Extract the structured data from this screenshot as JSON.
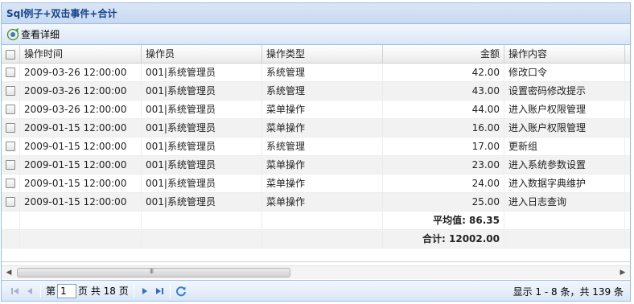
{
  "panel": {
    "title": "Sql例子+双击事件+合计"
  },
  "toolbar": {
    "view_detail_label": "查看详细"
  },
  "grid": {
    "columns": [
      "操作时间",
      "操作员",
      "操作类型",
      "金额",
      "操作内容"
    ],
    "rows": [
      [
        "2009-03-26 12:00:00",
        "001|系统管理员",
        "系统管理",
        "42.00",
        "修改口令"
      ],
      [
        "2009-03-26 12:00:00",
        "001|系统管理员",
        "系统管理",
        "43.00",
        "设置密码修改提示"
      ],
      [
        "2009-03-26 12:00:00",
        "001|系统管理员",
        "菜单操作",
        "44.00",
        "进入账户权限管理"
      ],
      [
        "2009-01-15 12:00:00",
        "001|系统管理员",
        "菜单操作",
        "16.00",
        "进入账户权限管理"
      ],
      [
        "2009-01-15 12:00:00",
        "001|系统管理员",
        "系统管理",
        "17.00",
        "更新组"
      ],
      [
        "2009-01-15 12:00:00",
        "001|系统管理员",
        "菜单操作",
        "23.00",
        "进入系统参数设置"
      ],
      [
        "2009-01-15 12:00:00",
        "001|系统管理员",
        "菜单操作",
        "24.00",
        "进入数据字典维护"
      ],
      [
        "2009-01-15 12:00:00",
        "001|系统管理员",
        "菜单操作",
        "25.00",
        "进入日志查询"
      ]
    ],
    "summary": {
      "average": "平均值: 86.35",
      "total": "合计: 12002.00"
    }
  },
  "scrollbar": {
    "grip": "III"
  },
  "pager": {
    "page_prefix": "第",
    "page_value": "1",
    "page_suffix": "页 共 18 页",
    "info": "显示 1 - 8 条，共 139 条"
  }
}
